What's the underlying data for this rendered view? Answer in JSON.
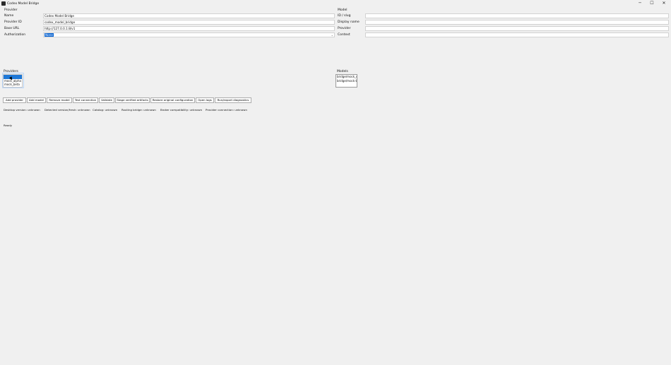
{
  "window": {
    "title": "Codex Model Bridge",
    "controls": {
      "minimize": "─",
      "maximize": "☐",
      "close": "✕"
    }
  },
  "provider": {
    "section_label": "Provider",
    "name_label": "Name",
    "name_value": "Codex Model Bridge",
    "provider_id_label": "Provider ID",
    "provider_id_value": "codex_model_bridge",
    "base_url_label": "Base URL",
    "base_url_value": "http://127.0.0.1:8/v1",
    "authorization_label": "Authorization",
    "authorization_value": "None"
  },
  "model": {
    "section_label": "Model",
    "id_label": "ID / slug",
    "id_value": "",
    "display_name_label": "Display name",
    "display_name_value": "",
    "provider_label": "Provider",
    "provider_value": "",
    "context_label": "Context",
    "context_value": ""
  },
  "providers_list": {
    "label": "Providers",
    "items": [
      "",
      "mock_alpha",
      "mock_beta"
    ],
    "selected_index": 0
  },
  "models_list": {
    "label": "Models",
    "items": [
      "bridge/mock_c",
      "bridge/mock-b"
    ]
  },
  "actions": {
    "add_provider": "Add provider",
    "add_model": "Add model",
    "remove_model": "Remove model",
    "test_connection": "Test connection",
    "validate": "Validate",
    "stage_verified_artifacts": "Stage verified artifacts",
    "restore_original_configuration": "Restore original configuration",
    "open_logs": "Open logs",
    "run_export_diagnostics": "Run/export diagnostics"
  },
  "status": {
    "desktop_version": "Desktop version: unknown",
    "detected_version": "Detected version/fresh: unknown",
    "catalog": "Catalog: unknown",
    "routing_bridge": "Routing bridge: unknown",
    "broker_compat": "Broker compatibility: unknown",
    "provider_connection": "Provider connection: unknown",
    "ready": "Ready"
  },
  "colors": {
    "background": "#f0f0f0",
    "selection": "#1e78d7",
    "combo_highlight": "#0a64d2"
  }
}
